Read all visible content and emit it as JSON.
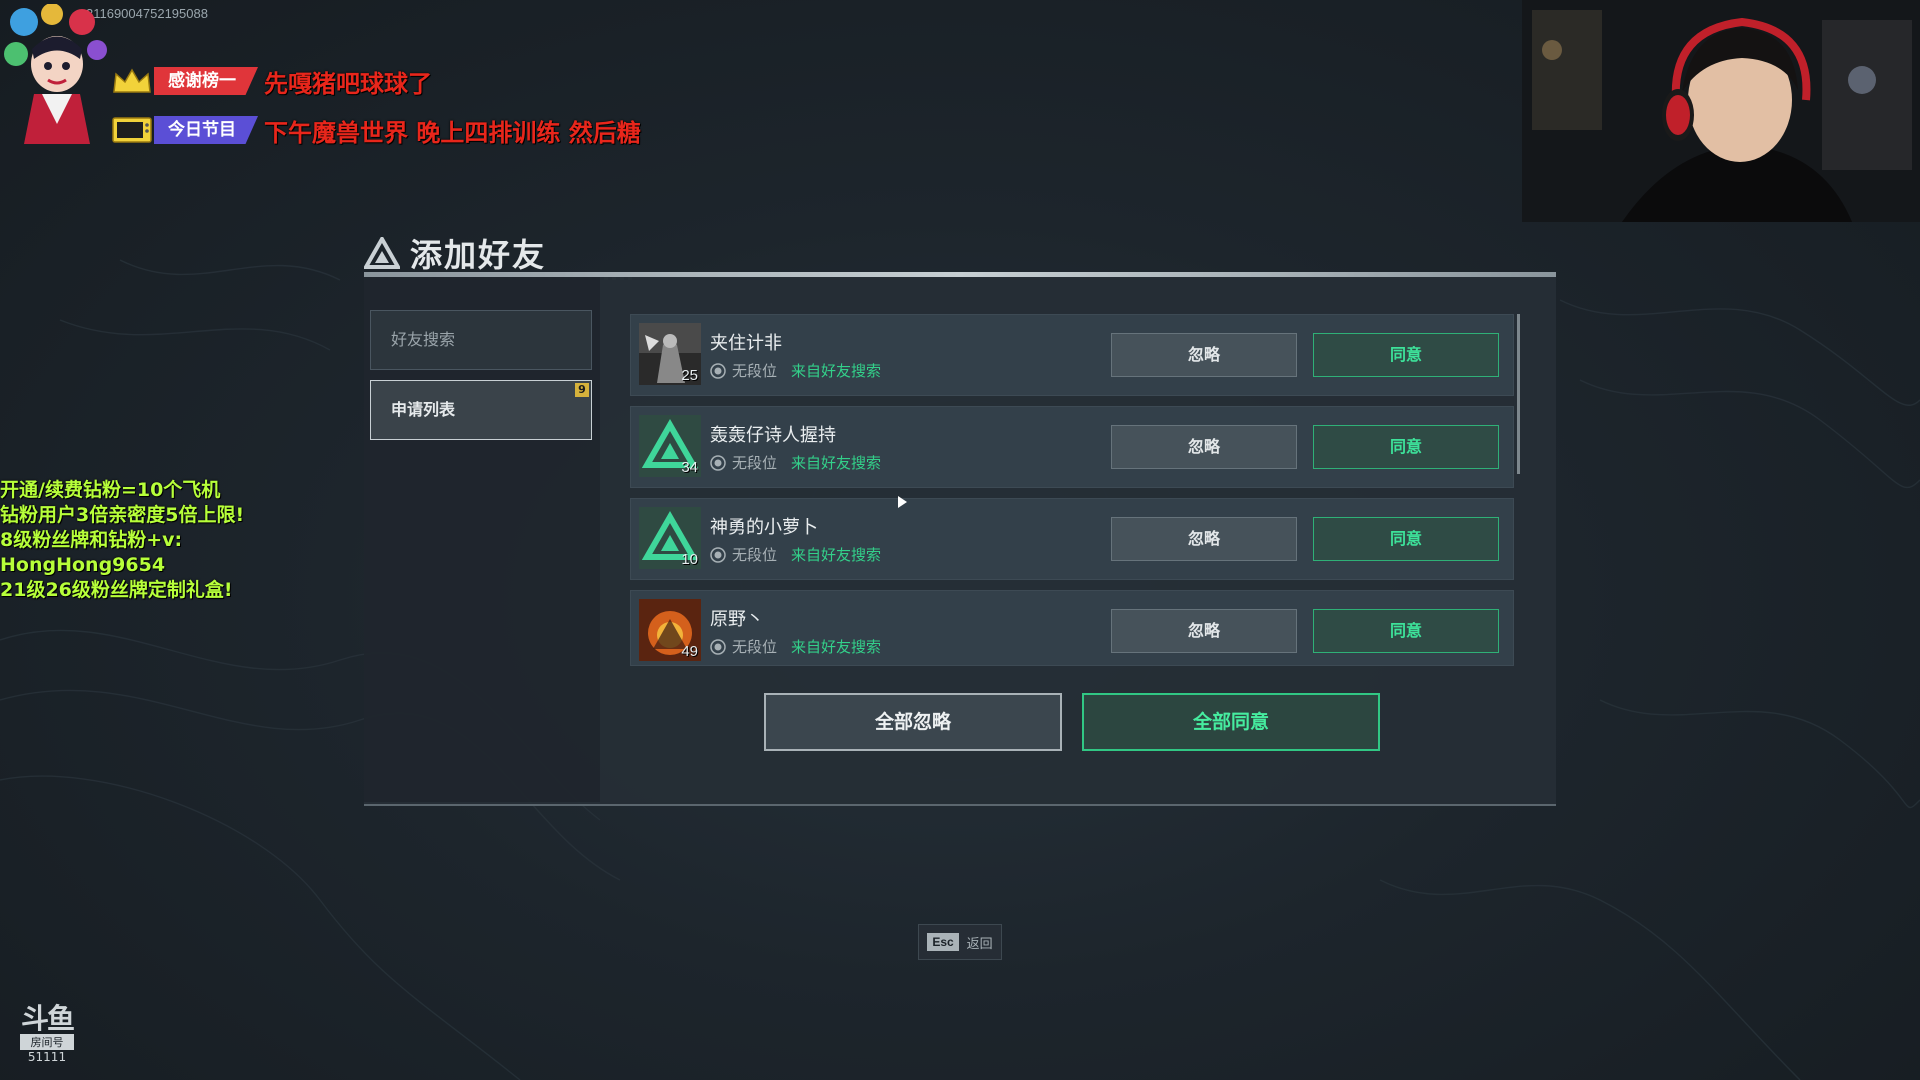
{
  "overlay": {
    "room_id": "31169004752195088",
    "tags": [
      {
        "label": "感谢榜一",
        "text": "先嘎猪吧球球了",
        "color": "#e0353a",
        "icon": "crown-icon"
      },
      {
        "label": "今日节目",
        "text": "下午魔兽世界 晚上四排训练 然后糖",
        "color": "#5b4fd6",
        "icon": "tv-icon"
      }
    ],
    "promo_lines": [
      "开通/续费钻粉=10个飞机",
      "钻粉用户3倍亲密度5倍上限!",
      "8级粉丝牌和钻粉+v:",
      "HongHong9654",
      "21级26级粉丝牌定制礼盒!"
    ],
    "douyu": {
      "logo": "斗鱼",
      "sub": "房间号",
      "room": "51111"
    }
  },
  "dialog": {
    "title": "添加好友",
    "sidebar": [
      {
        "label": "好友搜索",
        "active": false
      },
      {
        "label": "申请列表",
        "active": true,
        "badge": "9"
      }
    ],
    "requests": [
      {
        "name": "夹住计非",
        "level": "25",
        "rank": "无段位",
        "source": "来自好友搜索",
        "avatar": "photo-dark"
      },
      {
        "name": "轰轰仔诗人握持",
        "level": "34",
        "rank": "无段位",
        "source": "来自好友搜索",
        "avatar": "triangle-logo"
      },
      {
        "name": "神勇的小萝卜",
        "level": "10",
        "rank": "无段位",
        "source": "来自好友搜索",
        "avatar": "triangle-logo"
      },
      {
        "name": "原野丶",
        "level": "49",
        "rank": "无段位",
        "source": "来自好友搜索",
        "avatar": "photo-fire"
      }
    ],
    "ignore_label": "忽略",
    "accept_label": "同意",
    "ignore_all": "全部忽略",
    "accept_all": "全部同意",
    "esc_key": "Esc",
    "esc_label": "返回"
  },
  "colors": {
    "accent_green": "#3de29a",
    "badge": "#d6b23c"
  }
}
